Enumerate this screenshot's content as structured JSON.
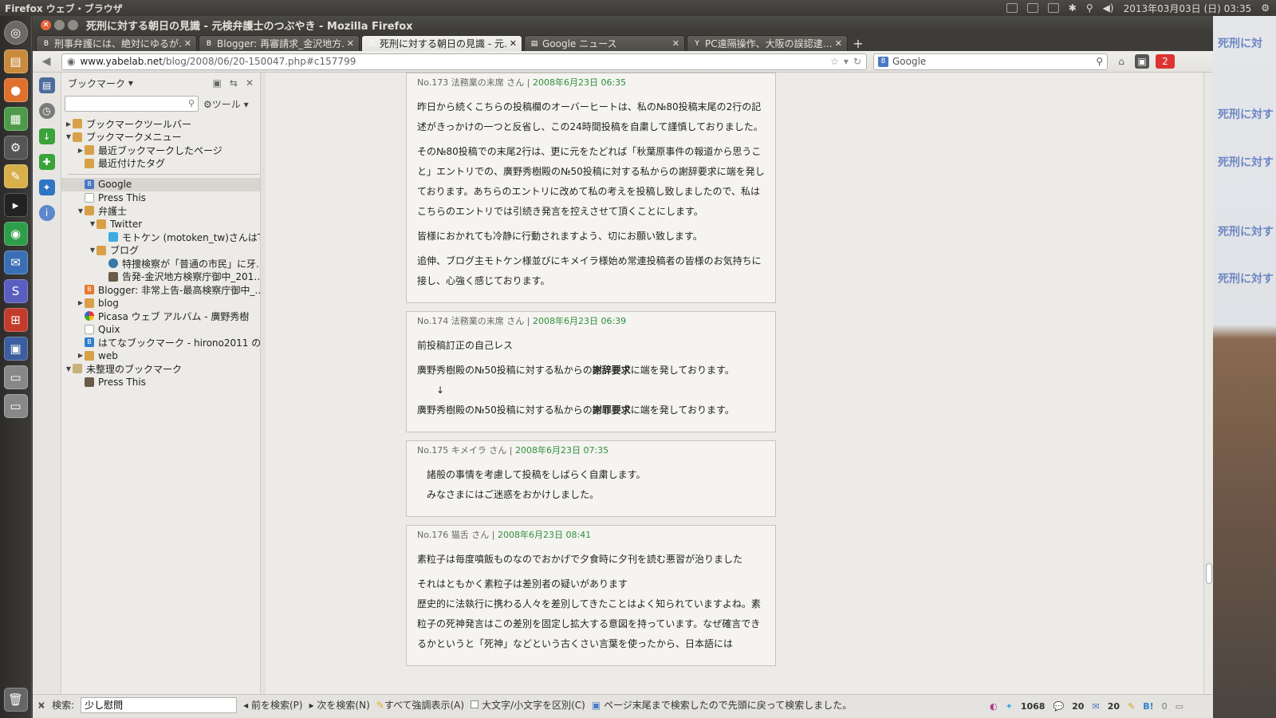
{
  "desktop": {
    "app_name": "Firefox ウェブ・ブラウザ",
    "clock": "2013年03月03日 (日) 03:35",
    "ghost_lines": [
      "死刑に対",
      "死刑に対す",
      "死刑に対す",
      "死刑に対す",
      "死刑に対す"
    ]
  },
  "window": {
    "title": "死刑に対する朝日の見識 - 元検弁護士のつぶやき - Mozilla Firefox"
  },
  "tabs": [
    {
      "label": "刑事弁護には、絶対にゆるが…",
      "color": "#e8782e",
      "active": false
    },
    {
      "label": "Blogger: 再審請求_金沢地方…",
      "color": "#e8782e",
      "active": false
    },
    {
      "label": "死刑に対する朝日の見識 - 元…",
      "color": "#4a78c5",
      "active": true
    },
    {
      "label": "Google ニュース",
      "color": "#888888",
      "active": false
    },
    {
      "label": "PC遠隔操作、大阪の誤認逮…",
      "color": "#3b5bbf",
      "active": false
    }
  ],
  "navbar": {
    "url_host": "www.yabelab.net",
    "url_path": "/blog/2008/06/20-150047.php#c157799",
    "search_placeholder": "Google",
    "mail_badge": "2"
  },
  "sidebar": {
    "header": "ブックマーク",
    "tools_label": "ツール",
    "tree": [
      {
        "label": "ブックマークツールバー",
        "depth": 0,
        "twisty": "▶",
        "icon": "folder"
      },
      {
        "label": "ブックマークメニュー",
        "depth": 0,
        "twisty": "▼",
        "icon": "folder"
      },
      {
        "label": "最近ブックマークしたページ",
        "depth": 1,
        "twisty": "▶",
        "icon": "folder"
      },
      {
        "label": "最近付けたタグ",
        "depth": 1,
        "twisty": "",
        "icon": "folder"
      },
      {
        "label": "",
        "depth": 0,
        "twisty": "",
        "icon": "sep"
      },
      {
        "label": "Google",
        "depth": 1,
        "twisty": "",
        "icon": "g",
        "selected": true
      },
      {
        "label": "Press This",
        "depth": 1,
        "twisty": "",
        "icon": "page"
      },
      {
        "label": "弁護士",
        "depth": 1,
        "twisty": "▼",
        "icon": "folder"
      },
      {
        "label": "Twitter",
        "depth": 2,
        "twisty": "▼",
        "icon": "folder"
      },
      {
        "label": "モトケン (motoken_tw)さんはT…",
        "depth": 3,
        "twisty": "",
        "icon": "tw2"
      },
      {
        "label": "ブログ",
        "depth": 2,
        "twisty": "▼",
        "icon": "folder"
      },
      {
        "label": "特捜検察が「普通の市民」に牙…",
        "depth": 3,
        "twisty": "",
        "icon": "wp"
      },
      {
        "label": "告発-金沢地方検察庁御中_201…",
        "depth": 3,
        "twisty": "",
        "icon": "im"
      },
      {
        "label": "Blogger: 非常上告-最高検察庁御中_…",
        "depth": 1,
        "twisty": "",
        "icon": "bl"
      },
      {
        "label": "blog",
        "depth": 1,
        "twisty": "▶",
        "icon": "folder"
      },
      {
        "label": "Picasa ウェブ アルバム - 廣野秀樹",
        "depth": 1,
        "twisty": "",
        "icon": "pc"
      },
      {
        "label": "Quix",
        "depth": 1,
        "twisty": "",
        "icon": "page"
      },
      {
        "label": "はてなブックマーク - hirono2011 のブ…",
        "depth": 1,
        "twisty": "",
        "icon": "hb"
      },
      {
        "label": "web",
        "depth": 1,
        "twisty": "▶",
        "icon": "folder"
      },
      {
        "label": "未整理のブックマーク",
        "depth": 0,
        "twisty": "▼",
        "icon": "orgf"
      },
      {
        "label": "Press This",
        "depth": 1,
        "twisty": "",
        "icon": "im"
      }
    ]
  },
  "comments": [
    {
      "num": "No.173",
      "author": "法務業の末席",
      "suffix": "さん |",
      "date": "2008年6月23日 06:35",
      "paragraphs": [
        "昨日から続くこちらの投稿欄のオーバーヒートは、私の№80投稿末尾の2行の記述がきっかけの一つと反省し、この24時間投稿を自粛して謹慎しておりました。",
        "その№80投稿での末尾2行は、更に元をたどれば「秋葉原事件の報道から思うこと」エントリでの、廣野秀樹殿の№50投稿に対する私からの謝辞要求に端を発しております。あちらのエントリに改めて私の考えを投稿し致しましたので、私はこちらのエントリでは引続き発言を控えさせて頂くことにします。",
        "皆様におかれても冷静に行動されますよう、切にお願い致します。",
        "追伸、ブログ主モトケン様並びにキメイラ様始め常連投稿者の皆様のお気持ちに接し、心強く感じております。"
      ]
    },
    {
      "num": "No.174",
      "author": "法務業の末席",
      "suffix": "さん |",
      "date": "2008年6月23日 06:39",
      "paragraphs": [
        "前投稿訂正の自己レス",
        "廣野秀樹殿の№50投稿に対する私からの",
        "↓",
        "廣野秀樹殿の№50投稿に対する私からの"
      ],
      "bold": [
        "謝辞要求",
        "謝罪要求"
      ],
      "tail": "に端を発しております。"
    },
    {
      "num": "No.175",
      "author": "キメイラ",
      "suffix": "さん |",
      "date": "2008年6月23日 07:35",
      "paragraphs": [
        "諸般の事情を考慮して投稿をしばらく自粛します。",
        "みなさまにはご迷惑をおかけしました。"
      ]
    },
    {
      "num": "No.176",
      "author": "猫舌",
      "suffix": "さん |",
      "date": "2008年6月23日 08:41",
      "paragraphs": [
        "素粒子は毎度噴飯ものなのでおかげで夕食時に夕刊を読む悪習が治りました",
        "それはともかく素粒子は差別者の疑いがあります",
        "歴史的に法執行に携わる人々を差別してきたことはよく知られていますよね。素粒子の死神発言はこの差別を固定し拡大する意図を持っています。なぜ確言できるかというと「死神」などという古くさい言葉を使ったから、日本語には"
      ]
    }
  ],
  "findbar": {
    "label": "検索:",
    "value": "少し慰問",
    "prev": "前を検索(P)",
    "next": "次を検索(N)",
    "highlight": "すべて強調表示(A)",
    "case": "大文字/小文字を区別(C)",
    "message": "ページ末尾まで検索したので先頭に戻って検索しました。"
  },
  "status": {
    "count1": "1068",
    "count2": "20",
    "count3": "20",
    "count4": "0"
  }
}
